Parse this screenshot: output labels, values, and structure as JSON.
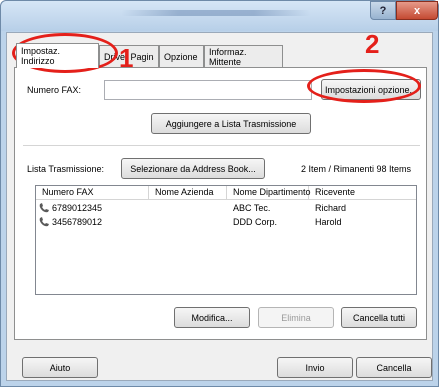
{
  "window": {
    "help_label": "?",
    "close_label": "x"
  },
  "tabs": [
    {
      "label": "Impostaz. Indirizzo",
      "active": true
    },
    {
      "label": "Driver Pagina",
      "active": false
    },
    {
      "label": "Opzione",
      "active": false
    },
    {
      "label": "Informaz. Mittente",
      "active": false
    }
  ],
  "fax": {
    "label": "Numero FAX:",
    "value": "",
    "options_button": "Impostazioni opzione...",
    "add_button": "Aggiungere a Lista Trasmissione"
  },
  "transmission": {
    "label": "Lista Trasmissione:",
    "select_button": "Selezionare da Address Book...",
    "count": "2 Item / Rimanenti 98 Items",
    "columns": [
      "Numero FAX",
      "Nome Azienda",
      "Nome Dipartimento",
      "Ricevente"
    ],
    "rows": [
      {
        "fax": "6789012345",
        "company": "",
        "department": "ABC Tec.",
        "recipient": "Richard"
      },
      {
        "fax": "3456789012",
        "company": "",
        "department": "DDD Corp.",
        "recipient": "Harold"
      }
    ],
    "edit_button": "Modifica...",
    "delete_button": "Elimina",
    "clear_button": "Cancella tutti"
  },
  "footer": {
    "help_button": "Aiuto",
    "send_button": "Invio",
    "cancel_button": "Cancella"
  },
  "annotations": {
    "marker_1": "1",
    "marker_2": "2",
    "color": "#e4201a"
  },
  "colors": {
    "window_frame": "#bcd3ea",
    "close_button": "#c44a32",
    "annotation": "#e4201a"
  }
}
